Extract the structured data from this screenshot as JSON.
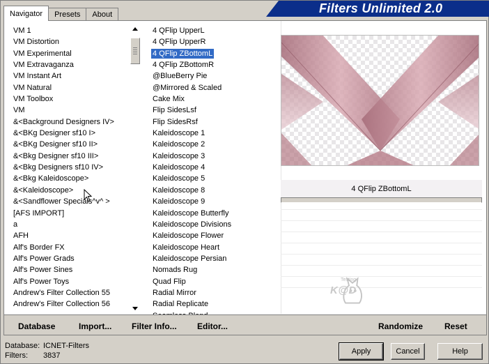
{
  "tabs": [
    {
      "label": "Navigator",
      "active": true
    },
    {
      "label": "Presets",
      "active": false
    },
    {
      "label": "About",
      "active": false
    }
  ],
  "banner_title": "Filters Unlimited 2.0",
  "categories": [
    "VM 1",
    "VM Distortion",
    "VM Experimental",
    "VM Extravaganza",
    "VM Instant Art",
    "VM Natural",
    "VM Toolbox",
    "VM",
    "&<Background Designers IV>",
    "&<BKg Designer sf10 I>",
    "&<BKg Designer sf10 II>",
    "&<Bkg Designer sf10 III>",
    "&<Bkg Designers sf10 IV>",
    "&<Bkg Kaleidoscope>",
    "&<Kaleidoscope>",
    "&<Sandflower Specials^v^ >",
    "[AFS IMPORT]",
    "a",
    "AFH",
    "Alf's Border FX",
    "Alf's Power Grads",
    "Alf's Power Sines",
    "Alf's Power Toys",
    "Andrew's Filter Collection 55",
    "Andrew's Filter Collection 56"
  ],
  "filters": [
    "4 QFlip UpperL",
    "4 QFlip UpperR",
    "4 QFlip ZBottomL",
    "4 QFlip ZBottomR",
    "@BlueBerry Pie",
    "@Mirrored & Scaled",
    "Cake Mix",
    "Flip SidesLsf",
    "Flip SidesRsf",
    "Kaleidoscope 1",
    "Kaleidoscope 2",
    "Kaleidoscope 3",
    "Kaleidoscope 4",
    "Kaleidoscope 5",
    "Kaleidoscope 8",
    "Kaleidoscope 9",
    "Kaleidoscope Butterfly",
    "Kaleidoscope Divisions",
    "Kaleidoscope Flower",
    "Kaleidoscope Heart",
    "Kaleidoscope Persian",
    "Nomads Rug",
    "Quad Flip",
    "Radial Mirror",
    "Radial Replicate",
    "Seamless Blend"
  ],
  "selected_filter_index": 2,
  "selected_filter_name": "4 QFlip ZBottomL",
  "logo_text": "K@D",
  "logo_subtext": "Testing",
  "toolbar": {
    "database": "Database",
    "import": "Import...",
    "filter_info": "Filter Info...",
    "editor": "Editor...",
    "randomize": "Randomize",
    "reset": "Reset"
  },
  "status": {
    "database_label": "Database:",
    "database_value": "ICNET-Filters",
    "filters_label": "Filters:",
    "filters_value": "3837"
  },
  "buttons": {
    "apply": "Apply",
    "cancel": "Cancel",
    "help": "Help"
  },
  "colors": {
    "selection": "#316ac5",
    "banner": "#0b2e8a",
    "preview_pink": "#b57a86"
  }
}
